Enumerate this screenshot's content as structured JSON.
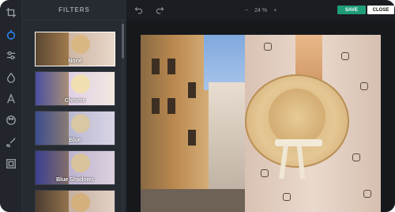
{
  "panel": {
    "title": "FILTERS",
    "filters": [
      {
        "label": "None"
      },
      {
        "label": "Chrome"
      },
      {
        "label": "Blue"
      },
      {
        "label": "Blue Shadows"
      },
      {
        "label": ""
      }
    ]
  },
  "toolbar": {
    "zoom_minus": "−",
    "zoom_value": "24 %",
    "zoom_plus": "+",
    "save_label": "SAVE",
    "close_label": "CLOSE"
  },
  "rail": {
    "tools": [
      "crop-icon",
      "filter-icon",
      "adjust-icon",
      "drop-icon",
      "text-icon",
      "palette-icon",
      "brush-icon",
      "frame-icon"
    ]
  },
  "colors": {
    "accent": "#2b8cff",
    "save": "#1f9d78",
    "panel": "#262a31",
    "background": "#1b1d22"
  }
}
